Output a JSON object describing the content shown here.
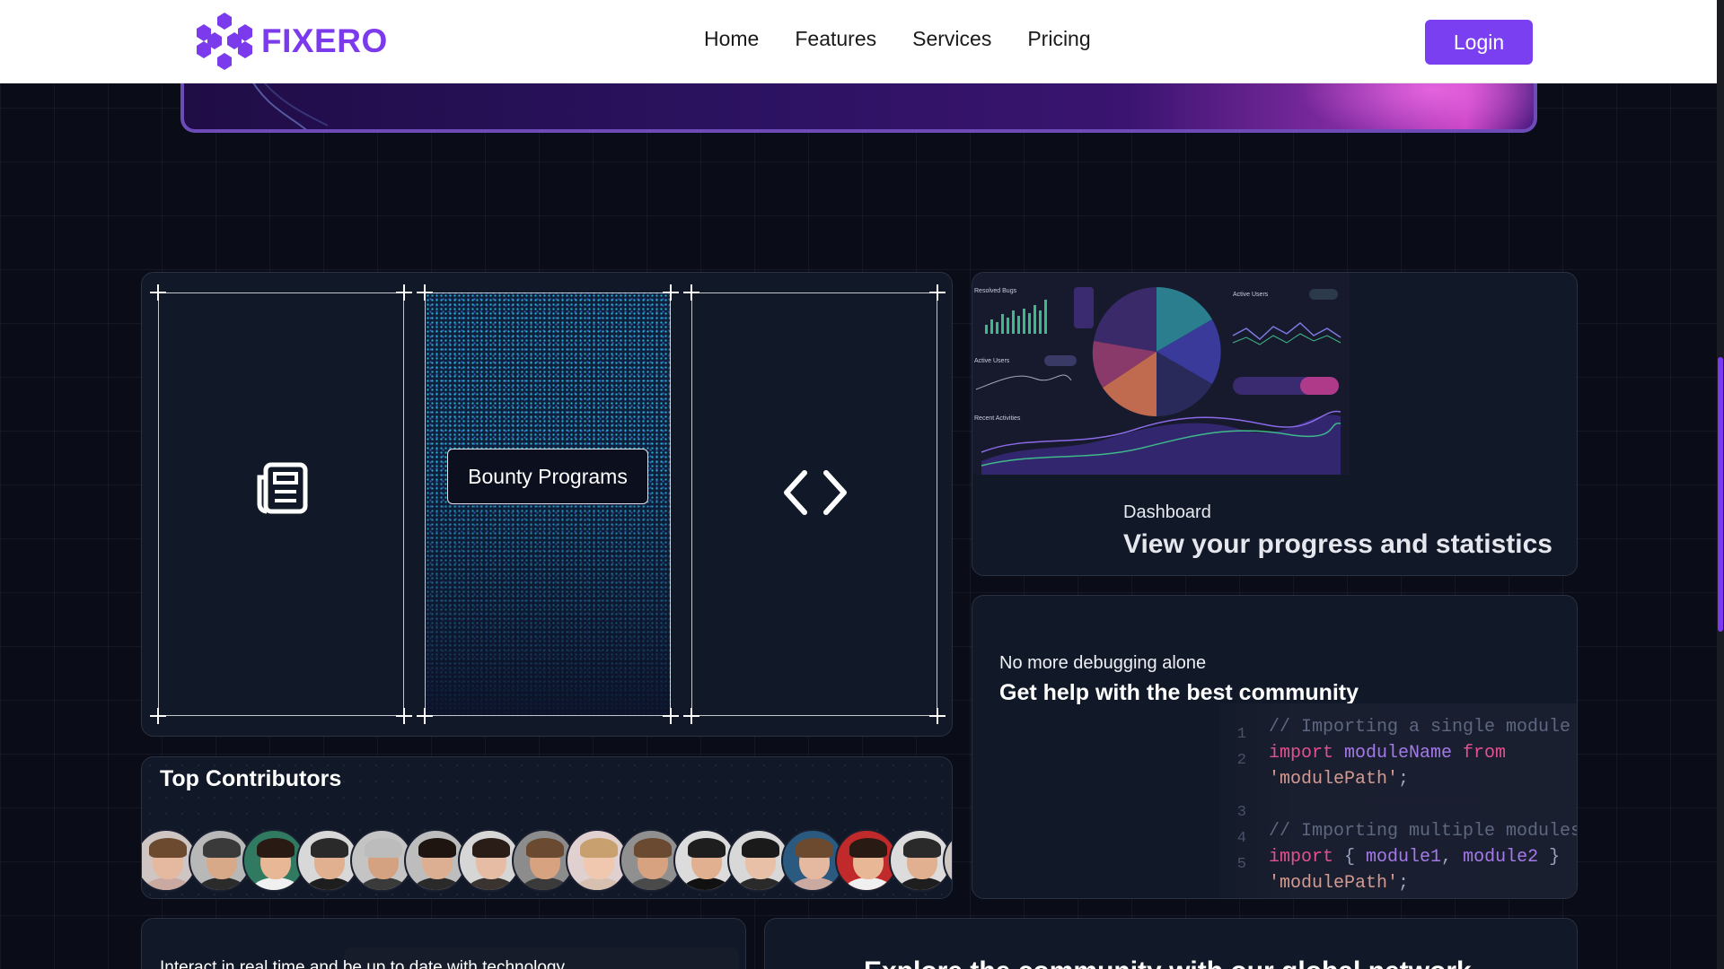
{
  "brand": {
    "name": "FIXERO",
    "accent_color": "#7c3aed"
  },
  "nav": {
    "links": [
      {
        "label": "Home"
      },
      {
        "label": "Features"
      },
      {
        "label": "Services"
      },
      {
        "label": "Pricing"
      }
    ],
    "login_label": "Login"
  },
  "features": {
    "left_icon": "newspaper-icon",
    "center_label": "Bounty Programs",
    "right_icon": "code-brackets-icon"
  },
  "dashboard": {
    "subtitle": "Dashboard",
    "title": "View your progress and statistics",
    "preview_labels": [
      "Resolved Bugs",
      "Active Users",
      "Active Users",
      "Recent Activities"
    ]
  },
  "community": {
    "subtitle": "No more debugging alone",
    "title": "Get help with the best community",
    "code_lines": [
      {
        "num": "1",
        "parts": [
          {
            "cls": "c-comment",
            "text": "// Importing a single module"
          }
        ]
      },
      {
        "num": "2",
        "parts": [
          {
            "cls": "c-kw",
            "text": "import "
          },
          {
            "cls": "c-id",
            "text": "moduleName "
          },
          {
            "cls": "c-kw",
            "text": "from"
          }
        ]
      },
      {
        "num": "",
        "parts": [
          {
            "cls": "c-str",
            "text": "'modulePath'"
          },
          {
            "cls": "c-brace",
            "text": ";"
          }
        ]
      },
      {
        "num": "3",
        "parts": []
      },
      {
        "num": "4",
        "parts": [
          {
            "cls": "c-comment",
            "text": "// Importing multiple modules"
          }
        ]
      },
      {
        "num": "5",
        "parts": [
          {
            "cls": "c-kw",
            "text": "import "
          },
          {
            "cls": "c-brace",
            "text": "{ "
          },
          {
            "cls": "c-id",
            "text": "module1"
          },
          {
            "cls": "c-brace",
            "text": ", "
          },
          {
            "cls": "c-id",
            "text": "module2 "
          },
          {
            "cls": "c-brace",
            "text": "}"
          }
        ]
      },
      {
        "num": "",
        "parts": [
          {
            "cls": "c-str",
            "text": "'modulePath'"
          },
          {
            "cls": "c-brace",
            "text": ";"
          }
        ]
      }
    ]
  },
  "contributors": {
    "title": "Top Contributors",
    "avatars": [
      {
        "skin": "#e5b8a0",
        "hair": "#6b4a30",
        "shirt": "#c9a9a0",
        "bg": "#cfc6c4"
      },
      {
        "skin": "#d8a988",
        "hair": "#3a3a3a",
        "shirt": "#2b2b2b",
        "bg": "#b8b8b8"
      },
      {
        "skin": "#e8b896",
        "hair": "#2a1a14",
        "shirt": "#f0f0f0",
        "bg": "#2f7a60"
      },
      {
        "skin": "#e0b090",
        "hair": "#2a2a2a",
        "shirt": "#1e1e1e",
        "bg": "#d8d8d8"
      },
      {
        "skin": "#d4a280",
        "hair": "#bcbcbc",
        "shirt": "#3a3a3a",
        "bg": "#c4c4c4"
      },
      {
        "skin": "#dcae92",
        "hair": "#1e1410",
        "shirt": "#2a2a2a",
        "bg": "#bdbdbd"
      },
      {
        "skin": "#e6bda4",
        "hair": "#2a1c16",
        "shirt": "#3a3330",
        "bg": "#d6d6d6"
      },
      {
        "skin": "#d6a280",
        "hair": "#6a4a30",
        "shirt": "#3a3a3a",
        "bg": "#8c8c8c"
      },
      {
        "skin": "#f0c8b0",
        "hair": "#c8a070",
        "shirt": "#d8c0b0",
        "bg": "#e0d0d0"
      },
      {
        "skin": "#d6a280",
        "hair": "#6a4a30",
        "shirt": "#4a4a4a",
        "bg": "#909090"
      },
      {
        "skin": "#e0b090",
        "hair": "#1e1e1e",
        "shirt": "#111111",
        "bg": "#dcdcdc"
      },
      {
        "skin": "#e8c0a8",
        "hair": "#1a1a1a",
        "shirt": "#2a2a2a",
        "bg": "#d8d8d8"
      },
      {
        "skin": "#e5b8a0",
        "hair": "#6b4a30",
        "shirt": "#c9a9a0",
        "bg": "#2a5a80"
      },
      {
        "skin": "#e8b896",
        "hair": "#2a1a14",
        "shirt": "#f0f0f0",
        "bg": "#c02a2a"
      },
      {
        "skin": "#e0b090",
        "hair": "#2a2a2a",
        "shirt": "#1e1e1e",
        "bg": "#dcdcdc"
      },
      {
        "skin": "#e5b8a0",
        "hair": "#6b4a30",
        "shirt": "#c9a9a0",
        "bg": "#cfc6c4"
      }
    ]
  },
  "bottom": {
    "left_text": "Interact in real time and be up to date with technology",
    "right_title": "Explore the community with our global network"
  }
}
